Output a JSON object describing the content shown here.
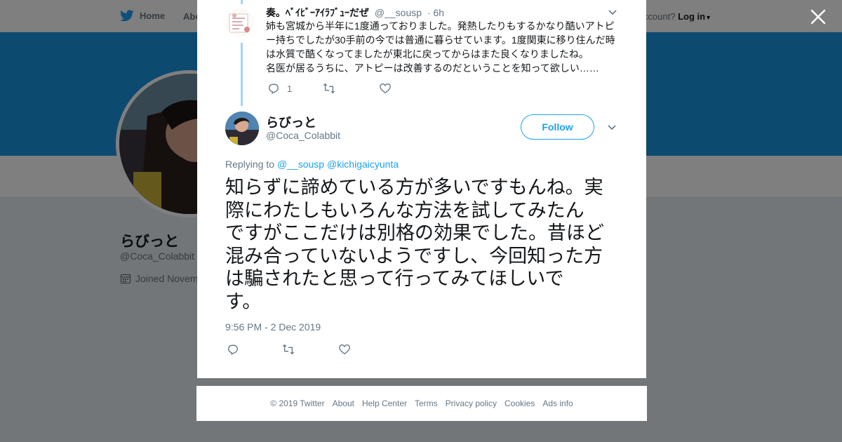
{
  "topnav": {
    "home_label": "Home",
    "about_label": "Abo",
    "account_prompt": "ccount?",
    "login_label": "Log in"
  },
  "background_profile": {
    "name": "らびっと",
    "handle": "@Coca_Colabbit",
    "joined": "Joined Novem"
  },
  "previous_tweet": {
    "name": "奏。ﾍﾞｲﾋﾞｰｱｲﾗﾌﾞｭｰだぜ",
    "handle": "@__sousp",
    "time": "· 6h",
    "text_lines": [
      "姉も宮城から半年に1度通っておりました。発熱したりもするかなり酷いアトピ",
      "ー持ちでしたが30手前の今では普通に暮らせています。1度関東に移り住んだ時",
      "は水質で酷くなってましたが東北に戻ってからはまた良くなりましたね。",
      "名医が居るうちに、アトピーは改善するのだということを知って欲しい……"
    ],
    "reply_count": "1"
  },
  "main_tweet": {
    "name": "らびっと",
    "handle": "@Coca_Colabbit",
    "follow_label": "Follow",
    "replying_prefix": "Replying to",
    "replying_to": [
      "@__sousp",
      "@kichigaicyunta"
    ],
    "text_lines": [
      "知らずに諦めている方が多いですもんね。実",
      "際にわたしもいろんな方法を試してみたん",
      "ですがここだけは別格の効果でした。昔ほど",
      "混み合っていないようですし、今回知った方",
      "は騙されたと思って行ってみてほしいで",
      "す。"
    ],
    "timestamp": "9:56 PM - 2 Dec 2019"
  },
  "footer": {
    "links": [
      "© 2019 Twitter",
      "About",
      "Help Center",
      "Terms",
      "Privacy policy",
      "Cookies",
      "Ads info"
    ]
  },
  "colors": {
    "twitter_blue": "#1da1f2",
    "banner_blue": "#1b95e0",
    "thread_line": "#a3d3f6",
    "secondary_text": "#657786"
  },
  "icons": {
    "logo": "twitter-bird-icon",
    "close": "close-icon",
    "reply": "reply-icon",
    "retweet": "retweet-icon",
    "like": "heart-icon",
    "caret": "chevron-down-icon",
    "calendar": "calendar-icon"
  }
}
